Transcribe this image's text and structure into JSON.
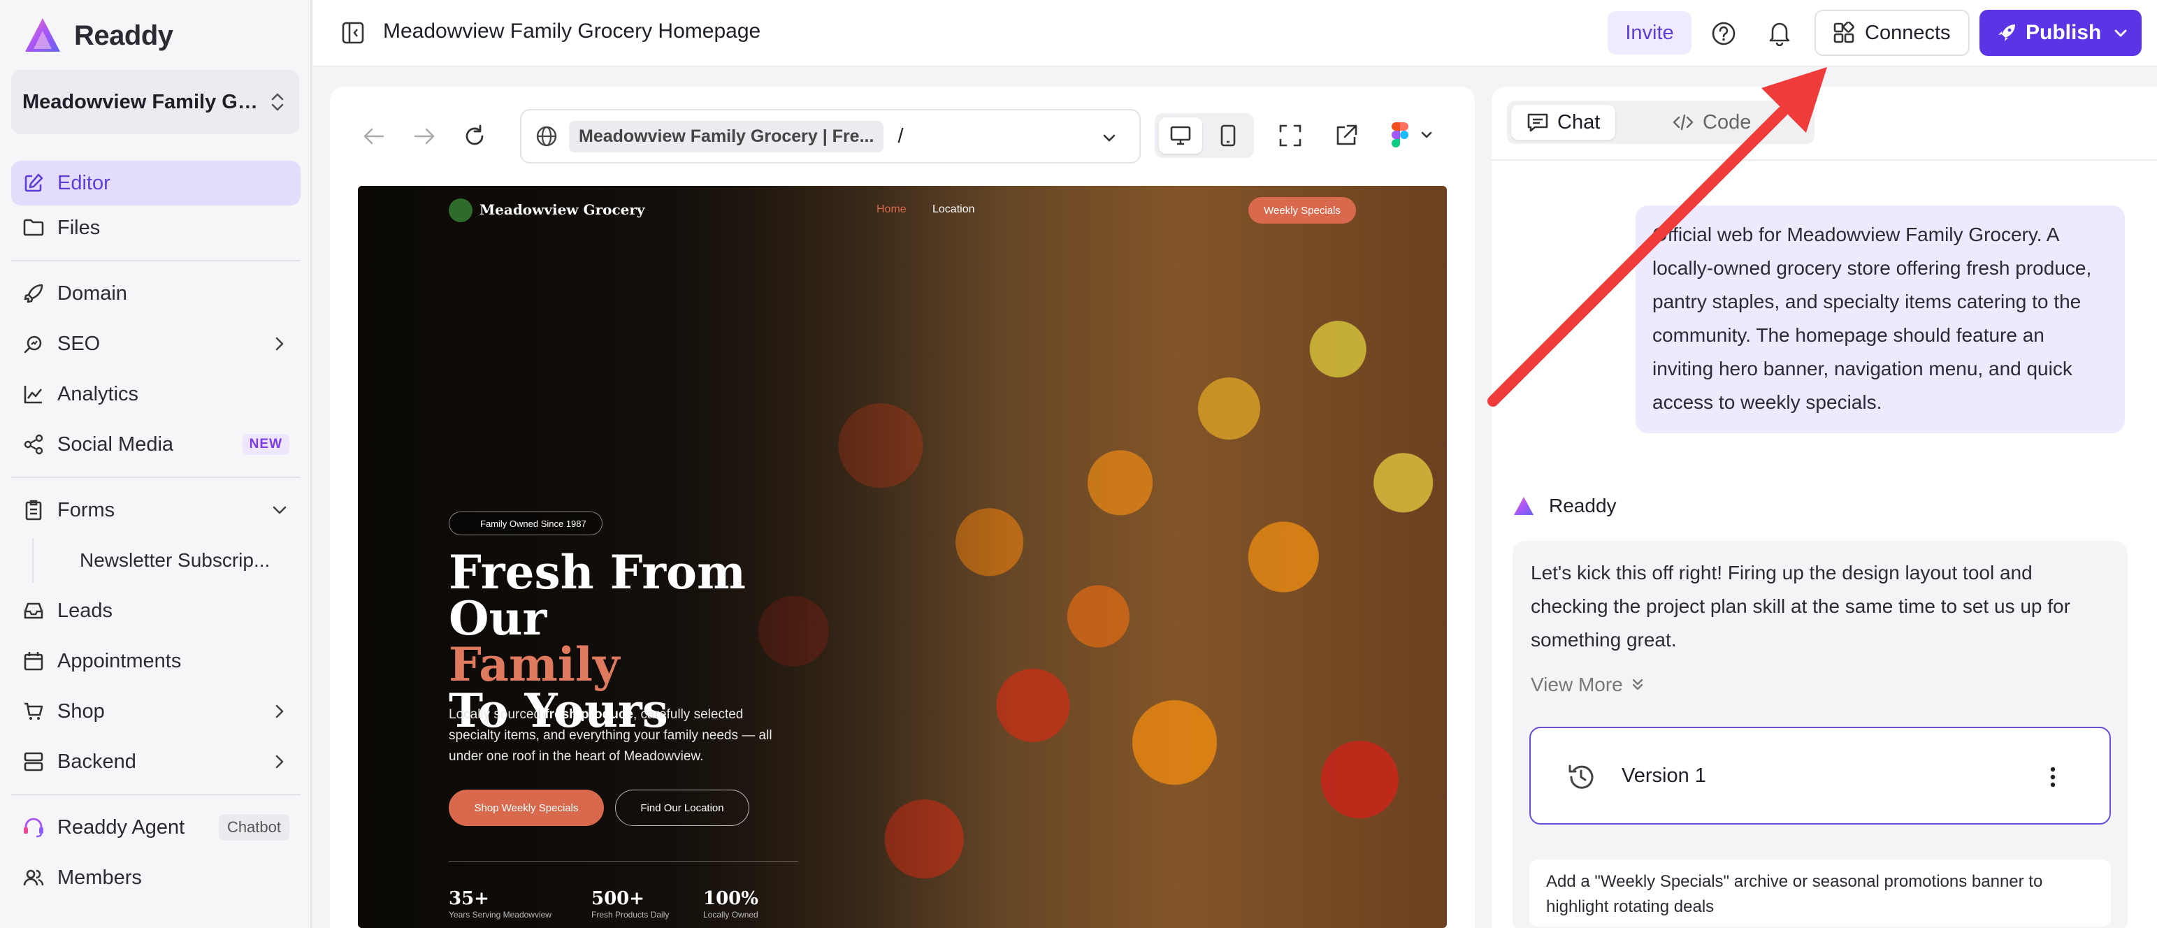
{
  "app": {
    "logo_text": "Readdy",
    "project_name": "Meadowview Family Grocery",
    "page_title": "Meadowview Family Grocery Homepage"
  },
  "sidebar": {
    "items": [
      {
        "label": "Editor",
        "icon": "edit-icon"
      },
      {
        "label": "Files",
        "icon": "folder-icon"
      },
      {
        "label": "Domain",
        "icon": "rocket-icon"
      },
      {
        "label": "SEO",
        "icon": "search-chart-icon"
      },
      {
        "label": "Analytics",
        "icon": "line-chart-icon"
      },
      {
        "label": "Social Media",
        "icon": "share-icon",
        "badge": "NEW"
      },
      {
        "label": "Forms",
        "icon": "clipboard-icon"
      },
      {
        "label": "Newsletter Subscrip..."
      },
      {
        "label": "Leads",
        "icon": "inbox-icon"
      },
      {
        "label": "Appointments",
        "icon": "calendar-icon"
      },
      {
        "label": "Shop",
        "icon": "cart-icon"
      },
      {
        "label": "Backend",
        "icon": "server-icon"
      },
      {
        "label": "Readdy Agent",
        "icon": "headset-icon",
        "badge": "Chatbot"
      },
      {
        "label": "Members",
        "icon": "users-icon"
      }
    ]
  },
  "topbar": {
    "invite": "Invite",
    "connects": "Connects",
    "publish": "Publish"
  },
  "browser": {
    "tab_title": "Meadowview Family Grocery | Fre...",
    "path": "/"
  },
  "site": {
    "logo": "Meadowview Grocery",
    "nav_home": "Home",
    "nav_location": "Location",
    "nav_cta": "Weekly Specials",
    "badge": "Family Owned Since 1987",
    "title_line1": "Fresh From Our",
    "title_line2": "Family",
    "title_line3": "To Yours",
    "desc_pre": "Locally sourced ",
    "desc_bold": "fresh produce",
    "desc_post": ", carefully selected specialty items, and everything your family needs — all under one roof in the heart of Meadowview.",
    "btn_shop": "Shop Weekly Specials",
    "btn_location": "Find Our Location",
    "stats": [
      {
        "num": "35+",
        "label": "Years Serving Meadowview"
      },
      {
        "num": "500+",
        "label": "Fresh Products Daily"
      },
      {
        "num": "100%",
        "label": "Locally Owned"
      }
    ]
  },
  "chat": {
    "tab_chat": "Chat",
    "tab_code": "Code",
    "user_message": "Official web for Meadowview Family Grocery. A locally-owned grocery store offering fresh produce, pantry staples, and specialty items catering to the community. The homepage should feature an inviting hero banner, navigation menu, and quick access to weekly specials.",
    "bot_name": "Readdy",
    "bot_message": "Let's kick this off right! Firing up the design layout tool and checking the project plan skill at the same time to set us up for something great.",
    "view_more": "View More",
    "version_label": "Version 1",
    "suggestion": "Add a \"Weekly Specials\" archive or seasonal promotions banner to highlight rotating deals"
  },
  "colors": {
    "accent": "#5b34e6",
    "annotation_arrow": "#f03b3b",
    "site_accent": "#d9694c"
  }
}
